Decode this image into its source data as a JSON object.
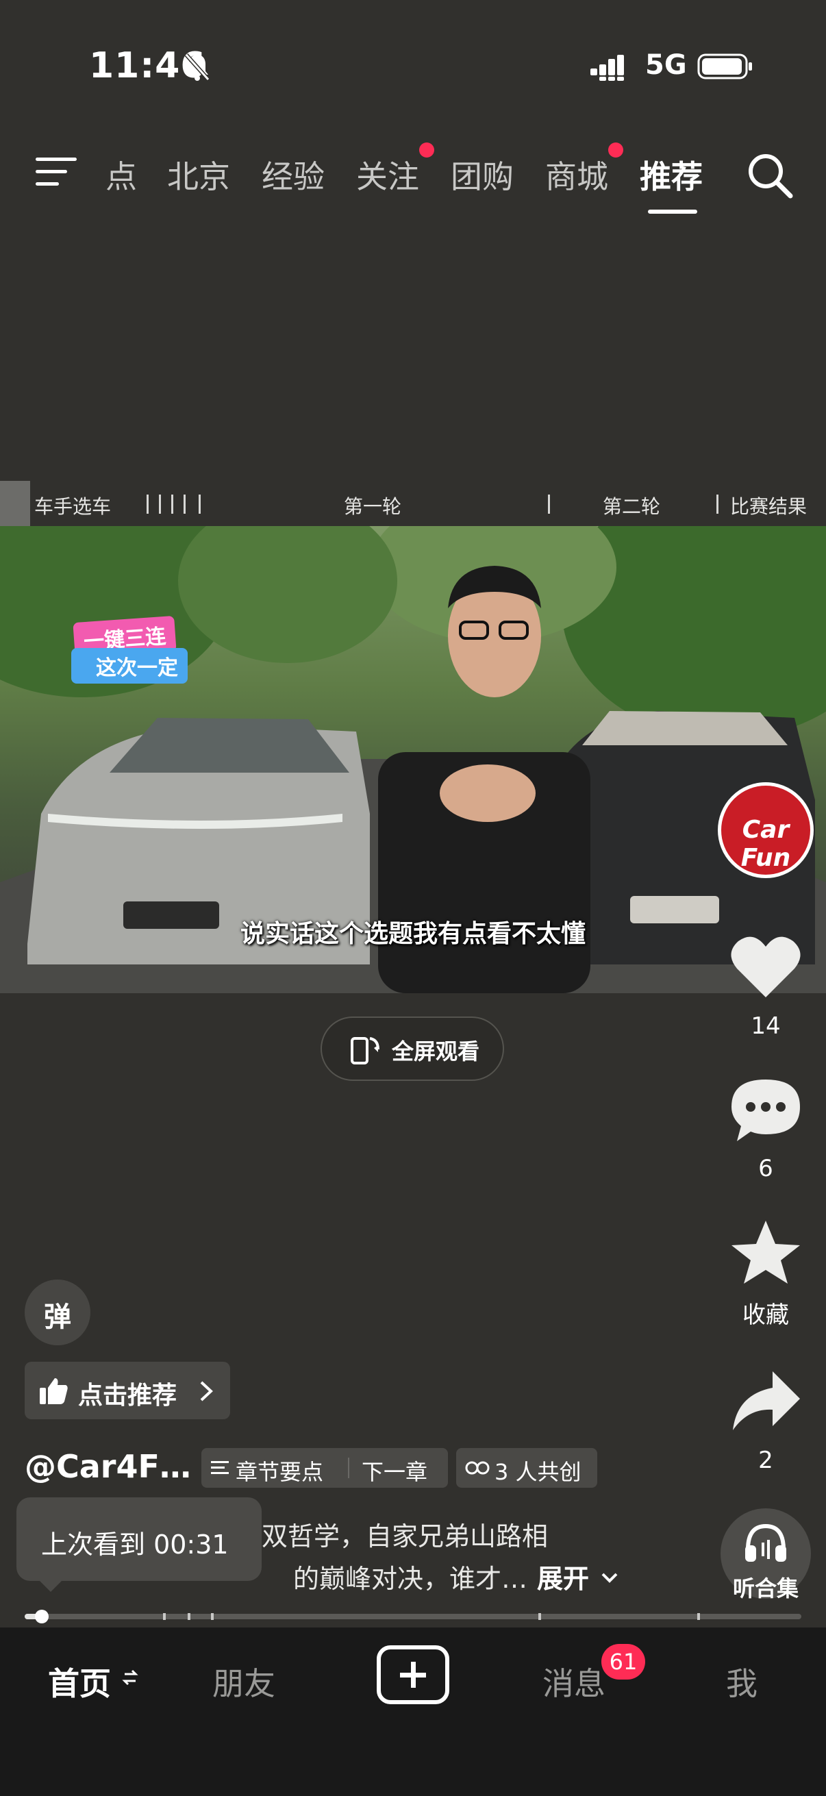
{
  "status_bar": {
    "time": "11:46",
    "network": "5G"
  },
  "top_nav": {
    "tabs": [
      {
        "label": "点",
        "active": false
      },
      {
        "label": "北京",
        "active": false
      },
      {
        "label": "经验",
        "active": false
      },
      {
        "label": "关注",
        "active": false,
        "dot": true
      },
      {
        "label": "团购",
        "active": false
      },
      {
        "label": "商城",
        "active": false,
        "dot": true
      },
      {
        "label": "推荐",
        "active": true
      }
    ]
  },
  "chapters": {
    "labels": [
      "车手选车",
      "第一轮",
      "第二轮",
      "比赛结果"
    ]
  },
  "video": {
    "subtitle": "说实话这个选题我有点看不太懂",
    "sticker_top": "一键三连",
    "sticker_bottom": "这次一定",
    "avatar_text": "Car Fun"
  },
  "fullscreen_button": "全屏观看",
  "right_rail": {
    "like_count": "14",
    "comment_count": "6",
    "favorite_label": "收藏",
    "share_count": "2",
    "listen_label": "听合集"
  },
  "danmaku_label": "弹",
  "recommend_label": "点击推荐",
  "author": "@Car4F…",
  "tags": {
    "chapter_points": "章节要点",
    "next_chapter": "下一章",
    "co_create": "3 人共创"
  },
  "description": {
    "line1": "双哲学，自家兄弟山路相",
    "line2": "的巅峰对决，谁才…",
    "expand": "展开"
  },
  "tooltip": "上次看到 00:31",
  "progress": {
    "fraction": 0.022
  },
  "bottom_nav": {
    "home": "首页",
    "friends": "朋友",
    "messages": "消息",
    "messages_badge": "61",
    "me": "我"
  },
  "colors": {
    "background": "#31302d",
    "accent_red": "#fe2c55",
    "bottom_nav": "#191919"
  }
}
